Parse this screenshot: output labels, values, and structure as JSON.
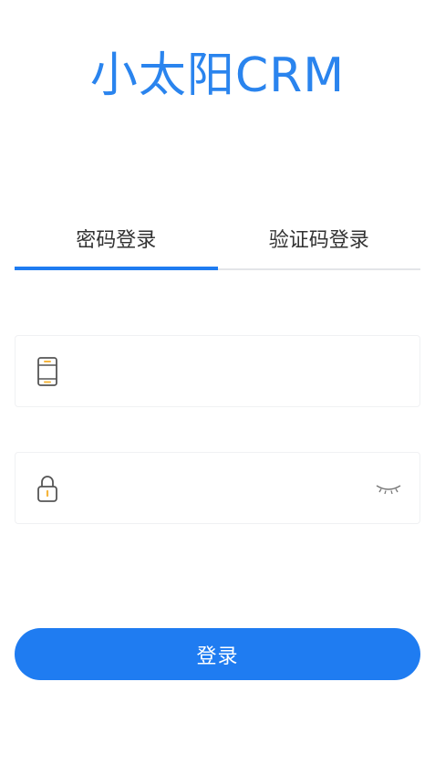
{
  "app": {
    "title": "小太阳CRM"
  },
  "tabs": [
    {
      "label": "密码登录",
      "active": true
    },
    {
      "label": "验证码登录",
      "active": false
    }
  ],
  "form": {
    "phone": {
      "value": "",
      "placeholder": "",
      "icon": "phone-icon"
    },
    "password": {
      "value": "",
      "placeholder": "",
      "icon": "lock-icon",
      "toggle_icon": "eye-closed-icon"
    },
    "submit_label": "登录"
  },
  "colors": {
    "accent": "#1f7cf1",
    "title": "#2a84ee",
    "icon_highlight": "#f5b53c",
    "icon_stroke": "#555555"
  }
}
